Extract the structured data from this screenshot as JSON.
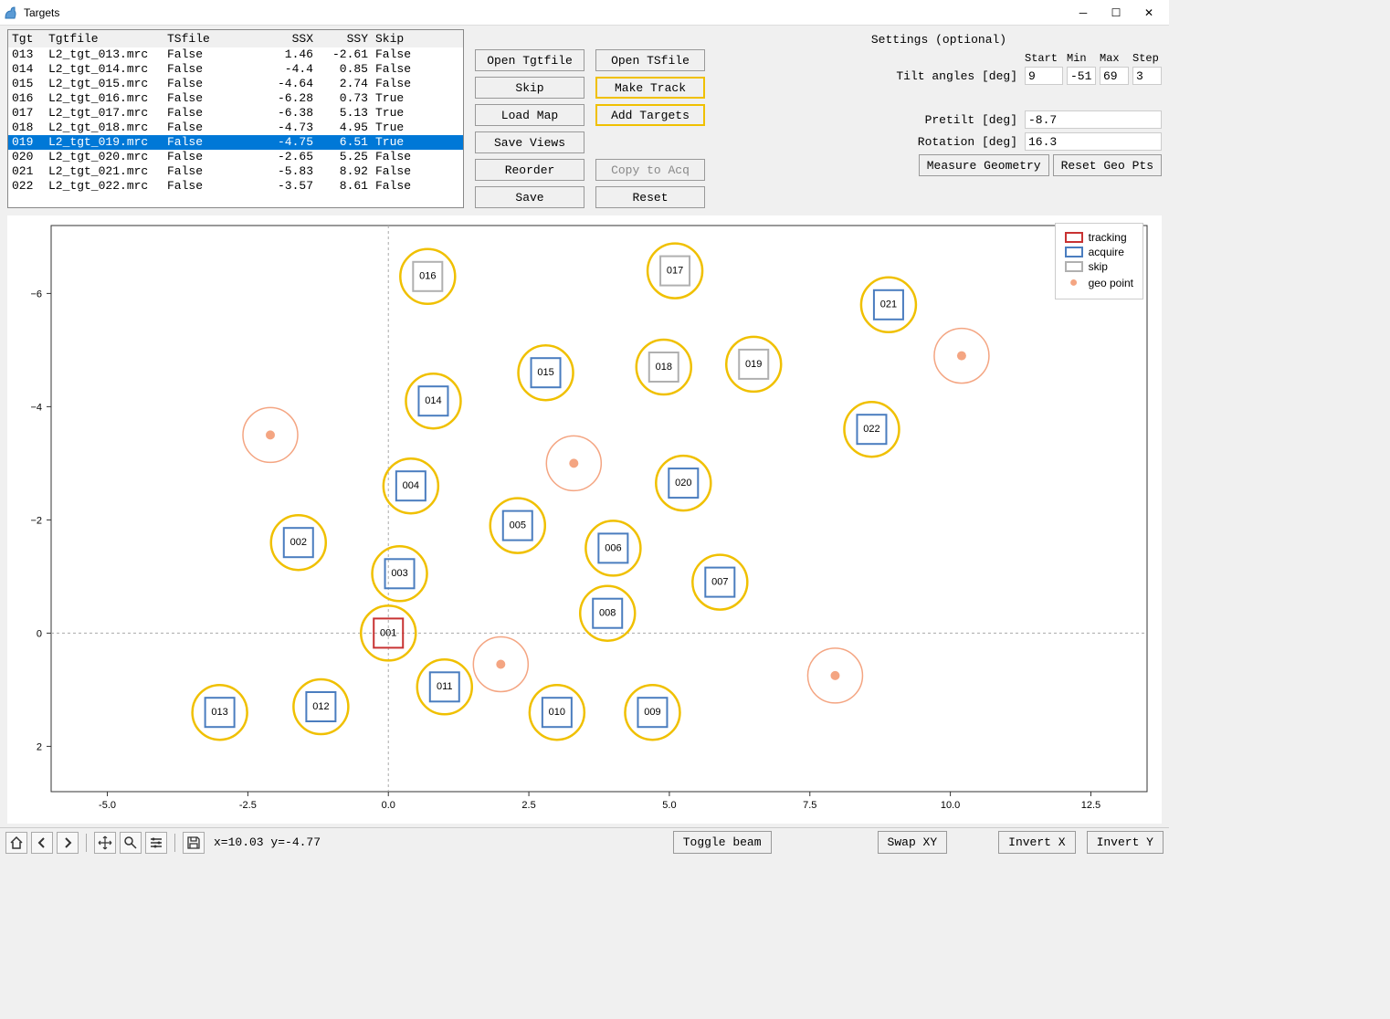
{
  "window": {
    "title": "Targets"
  },
  "table": {
    "headers": {
      "tgt": "Tgt",
      "tgtfile": "Tgtfile",
      "tsfile": "TSfile",
      "ssx": "SSX",
      "ssy": "SSY",
      "skip": "Skip"
    },
    "rows": [
      {
        "tgt": "013",
        "tgtfile": "L2_tgt_013.mrc",
        "tsfile": "False",
        "ssx": "1.46",
        "ssy": "-2.61",
        "skip": "False",
        "selected": false
      },
      {
        "tgt": "014",
        "tgtfile": "L2_tgt_014.mrc",
        "tsfile": "False",
        "ssx": "-4.4",
        "ssy": "0.85",
        "skip": "False",
        "selected": false
      },
      {
        "tgt": "015",
        "tgtfile": "L2_tgt_015.mrc",
        "tsfile": "False",
        "ssx": "-4.64",
        "ssy": "2.74",
        "skip": "False",
        "selected": false
      },
      {
        "tgt": "016",
        "tgtfile": "L2_tgt_016.mrc",
        "tsfile": "False",
        "ssx": "-6.28",
        "ssy": "0.73",
        "skip": "True",
        "selected": false
      },
      {
        "tgt": "017",
        "tgtfile": "L2_tgt_017.mrc",
        "tsfile": "False",
        "ssx": "-6.38",
        "ssy": "5.13",
        "skip": "True",
        "selected": false
      },
      {
        "tgt": "018",
        "tgtfile": "L2_tgt_018.mrc",
        "tsfile": "False",
        "ssx": "-4.73",
        "ssy": "4.95",
        "skip": "True",
        "selected": false
      },
      {
        "tgt": "019",
        "tgtfile": "L2_tgt_019.mrc",
        "tsfile": "False",
        "ssx": "-4.75",
        "ssy": "6.51",
        "skip": "True",
        "selected": true
      },
      {
        "tgt": "020",
        "tgtfile": "L2_tgt_020.mrc",
        "tsfile": "False",
        "ssx": "-2.65",
        "ssy": "5.25",
        "skip": "False",
        "selected": false
      },
      {
        "tgt": "021",
        "tgtfile": "L2_tgt_021.mrc",
        "tsfile": "False",
        "ssx": "-5.83",
        "ssy": "8.92",
        "skip": "False",
        "selected": false
      },
      {
        "tgt": "022",
        "tgtfile": "L2_tgt_022.mrc",
        "tsfile": "False",
        "ssx": "-3.57",
        "ssy": "8.61",
        "skip": "False",
        "selected": false
      }
    ]
  },
  "buttons": {
    "open_tgtfile": "Open Tgtfile",
    "open_tsfile": "Open TSfile",
    "skip": "Skip",
    "make_track": "Make Track",
    "load_map": "Load Map",
    "add_targets": "Add Targets",
    "save_views": "Save Views",
    "reorder": "Reorder",
    "copy_to_acq": "Copy to Acq",
    "save": "Save",
    "reset": "Reset"
  },
  "settings": {
    "title": "Settings (optional)",
    "headers": {
      "start": "Start",
      "min": "Min",
      "max": "Max",
      "step": "Step"
    },
    "tilt_label": "Tilt angles [deg]",
    "tilt": {
      "start": "9",
      "min": "-51",
      "max": "69",
      "step": "3"
    },
    "pretilt_label": "Pretilt [deg]",
    "pretilt": "-8.7",
    "rotation_label": "Rotation [deg]",
    "rotation": "16.3",
    "measure_geometry": "Measure Geometry",
    "reset_geo_pts": "Reset Geo Pts"
  },
  "chart_data": {
    "type": "scatter",
    "xlim": [
      -6,
      13.5
    ],
    "ylim": [
      -7.2,
      2.8
    ],
    "xticks": [
      -5.0,
      -2.5,
      0.0,
      2.5,
      5.0,
      7.5,
      10.0,
      12.5
    ],
    "yticks": [
      -6,
      -4,
      -2,
      0,
      2
    ],
    "targets": [
      {
        "id": "001",
        "x": 0.0,
        "y": 0.0,
        "type": "tracking"
      },
      {
        "id": "002",
        "x": -1.6,
        "y": -1.6,
        "type": "acquire"
      },
      {
        "id": "003",
        "x": 0.2,
        "y": -1.05,
        "type": "acquire"
      },
      {
        "id": "004",
        "x": 0.4,
        "y": -2.6,
        "type": "acquire"
      },
      {
        "id": "005",
        "x": 2.3,
        "y": -1.9,
        "type": "acquire"
      },
      {
        "id": "006",
        "x": 4.0,
        "y": -1.5,
        "type": "acquire"
      },
      {
        "id": "007",
        "x": 5.9,
        "y": -0.9,
        "type": "acquire"
      },
      {
        "id": "008",
        "x": 3.9,
        "y": -0.35,
        "type": "acquire"
      },
      {
        "id": "009",
        "x": 4.7,
        "y": 1.4,
        "type": "acquire"
      },
      {
        "id": "010",
        "x": 3.0,
        "y": 1.4,
        "type": "acquire"
      },
      {
        "id": "011",
        "x": 1.0,
        "y": 0.95,
        "type": "acquire"
      },
      {
        "id": "012",
        "x": -1.2,
        "y": 1.3,
        "type": "acquire"
      },
      {
        "id": "013",
        "x": -3.0,
        "y": 1.4,
        "type": "acquire"
      },
      {
        "id": "014",
        "x": 0.8,
        "y": -4.1,
        "type": "acquire"
      },
      {
        "id": "015",
        "x": 2.8,
        "y": -4.6,
        "type": "acquire"
      },
      {
        "id": "016",
        "x": 0.7,
        "y": -6.3,
        "type": "skip"
      },
      {
        "id": "017",
        "x": 5.1,
        "y": -6.4,
        "type": "skip"
      },
      {
        "id": "018",
        "x": 4.9,
        "y": -4.7,
        "type": "skip"
      },
      {
        "id": "019",
        "x": 6.5,
        "y": -4.75,
        "type": "skip"
      },
      {
        "id": "020",
        "x": 5.25,
        "y": -2.65,
        "type": "acquire"
      },
      {
        "id": "021",
        "x": 8.9,
        "y": -5.8,
        "type": "acquire"
      },
      {
        "id": "022",
        "x": 8.6,
        "y": -3.6,
        "type": "acquire"
      }
    ],
    "geo_points": [
      {
        "x": -2.1,
        "y": -3.5
      },
      {
        "x": 3.3,
        "y": -3.0
      },
      {
        "x": 2.0,
        "y": 0.55
      },
      {
        "x": 7.95,
        "y": 0.75
      },
      {
        "x": 10.2,
        "y": -4.9
      }
    ],
    "legend": {
      "tracking": "tracking",
      "acquire": "acquire",
      "skip": "skip",
      "geo": "geo point"
    }
  },
  "toolbar": {
    "coords": "x=10.03 y=-4.77",
    "toggle_beam": "Toggle beam",
    "swap_xy": "Swap XY",
    "invert_x": "Invert X",
    "invert_y": "Invert Y"
  }
}
